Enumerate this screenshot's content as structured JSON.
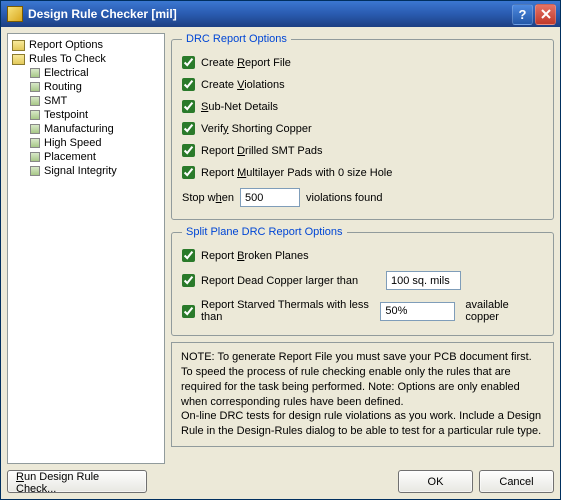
{
  "title": "Design Rule Checker [mil]",
  "tree": {
    "root": [
      "Report Options",
      "Rules To Check"
    ],
    "rules_children": [
      "Electrical",
      "Routing",
      "SMT",
      "Testpoint",
      "Manufacturing",
      "High Speed",
      "Placement",
      "Signal Integrity"
    ]
  },
  "drc": {
    "legend": "DRC Report Options",
    "create_report_pre": "Create ",
    "create_report_u": "R",
    "create_report_post": "eport File",
    "create_violations_pre": "Create ",
    "create_violations_u": "V",
    "create_violations_post": "iolations",
    "subnet_pre": "",
    "subnet_u": "S",
    "subnet_post": "ub-Net Details",
    "verify_pre": "Verif",
    "verify_u": "y",
    "verify_post": " Shorting Copper",
    "smt_pre": "Report ",
    "smt_u": "D",
    "smt_post": "rilled SMT Pads",
    "multilayer_pre": "Report ",
    "multilayer_u": "M",
    "multilayer_post": "ultilayer Pads with 0 size Hole",
    "stop_pre": "Stop w",
    "stop_u": "h",
    "stop_post": "en",
    "stop_value": "500",
    "stop_suffix": "violations found"
  },
  "split": {
    "legend": "Split Plane DRC Report Options",
    "broken_pre": "Report ",
    "broken_u": "B",
    "broken_post": "roken Planes",
    "dead_label": "Report Dead Copper larger than",
    "dead_value": "100 sq. mils",
    "starved_label": "Report Starved Thermals with less than",
    "starved_value": "50%",
    "starved_suffix": "available copper"
  },
  "note": {
    "l1": "NOTE: To generate Report File you must save your PCB document first.",
    "l2": "To speed the process of rule checking enable only the rules that are required for the task being performed.  Note: Options are only enabled when corresponding rules have been defined.",
    "l3": "On-line DRC tests for design rule violations as you work. Include a Design Rule in the Design-Rules dialog to be able to test for a particular rule  type."
  },
  "buttons": {
    "run": "Run Design Rule Check...",
    "ok": "OK",
    "cancel": "Cancel"
  }
}
